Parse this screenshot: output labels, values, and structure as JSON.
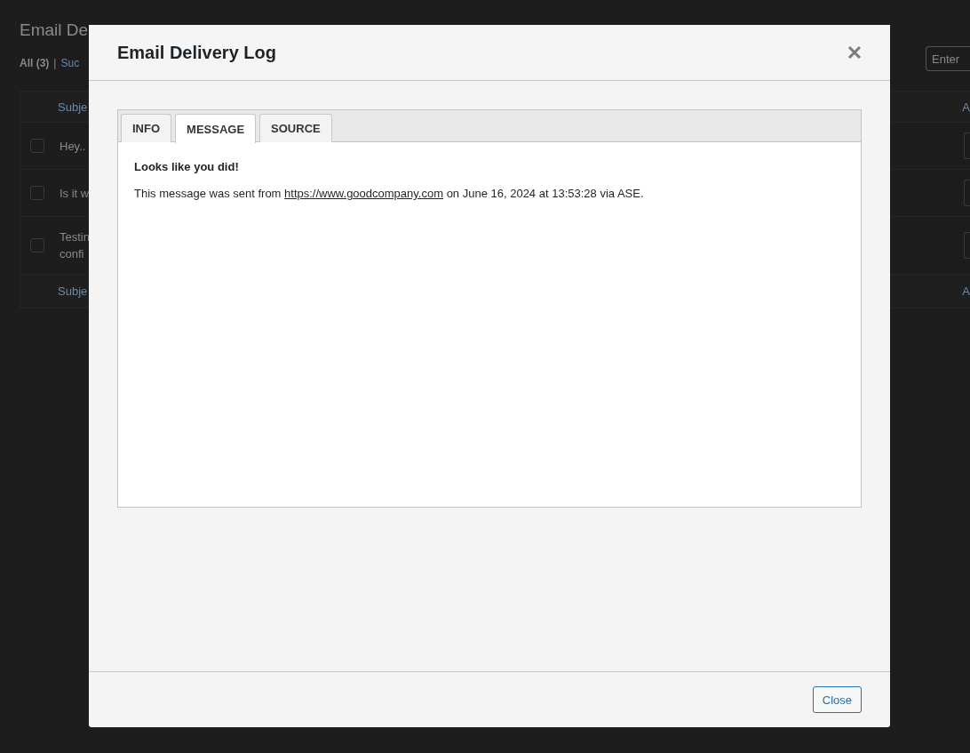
{
  "page": {
    "title": "Email De",
    "filters": [
      {
        "label": "All",
        "count": "(3)",
        "selected": true
      },
      {
        "label": "Suc",
        "selected": false
      }
    ],
    "filter_separator": "|",
    "search": {
      "placeholder": "Enter"
    },
    "table": {
      "columns": [
        "Subje",
        "A"
      ],
      "rows": [
        {
          "subject": [
            "Hey.."
          ],
          "checked": false
        },
        {
          "subject": [
            "Is it w"
          ],
          "checked": false
        },
        {
          "subject": [
            "Testin",
            "confi"
          ],
          "checked": false
        }
      ],
      "footer": [
        "Subje",
        "A"
      ]
    }
  },
  "modal": {
    "title": "Email Delivery Log",
    "tabs": [
      {
        "label": "INFO",
        "selected": false
      },
      {
        "label": "MESSAGE",
        "selected": true
      },
      {
        "label": "SOURCE",
        "selected": false
      }
    ],
    "message": {
      "heading": "Looks like you did!",
      "text_before": "This message was sent from ",
      "link": "https://www.goodcompany.com",
      "text_after": " on June 16, 2024 at 13:53:28 via ASE."
    },
    "close_button": "Close"
  }
}
